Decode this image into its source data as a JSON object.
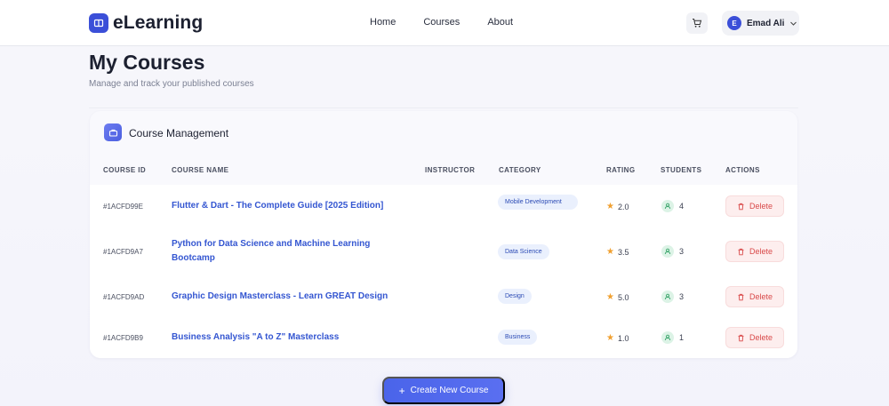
{
  "header": {
    "logo_text": "eLearning",
    "nav": [
      "Home",
      "Courses",
      "About"
    ],
    "user": {
      "initial": "E",
      "name": "Emad Ali"
    }
  },
  "page": {
    "title": "My Courses",
    "subtitle": "Manage and track your published courses"
  },
  "card": {
    "title": "Course Management",
    "columns": {
      "id": "COURSE ID",
      "name": "COURSE NAME",
      "instructor": "INSTRUCTOR",
      "category": "CATEGORY",
      "rating": "RATING",
      "students": "STUDENTS",
      "actions": "ACTIONS"
    },
    "delete_label": "Delete",
    "rows": [
      {
        "id": "#1ACFD99E",
        "name": "Flutter & Dart - The Complete Guide [2025 Edition]",
        "category": "Mobile Development",
        "rating": "2.0",
        "students": "4"
      },
      {
        "id": "#1ACFD9A7",
        "name": "Python for Data Science and Machine Learning Bootcamp",
        "category": "Data Science",
        "rating": "3.5",
        "students": "3"
      },
      {
        "id": "#1ACFD9AD",
        "name": "Graphic Design Masterclass - Learn GREAT Design",
        "category": "Design",
        "rating": "5.0",
        "students": "3"
      },
      {
        "id": "#1ACFD9B9",
        "name": "Business Analysis \"A to Z\" Masterclass",
        "category": "Business",
        "rating": "1.0",
        "students": "1"
      }
    ]
  },
  "actions": {
    "create_label": "Create New Course"
  },
  "colors": {
    "accent": "#3b4fd8",
    "link": "#3456d1",
    "danger": "#d94a4a",
    "star": "#f0a030"
  }
}
